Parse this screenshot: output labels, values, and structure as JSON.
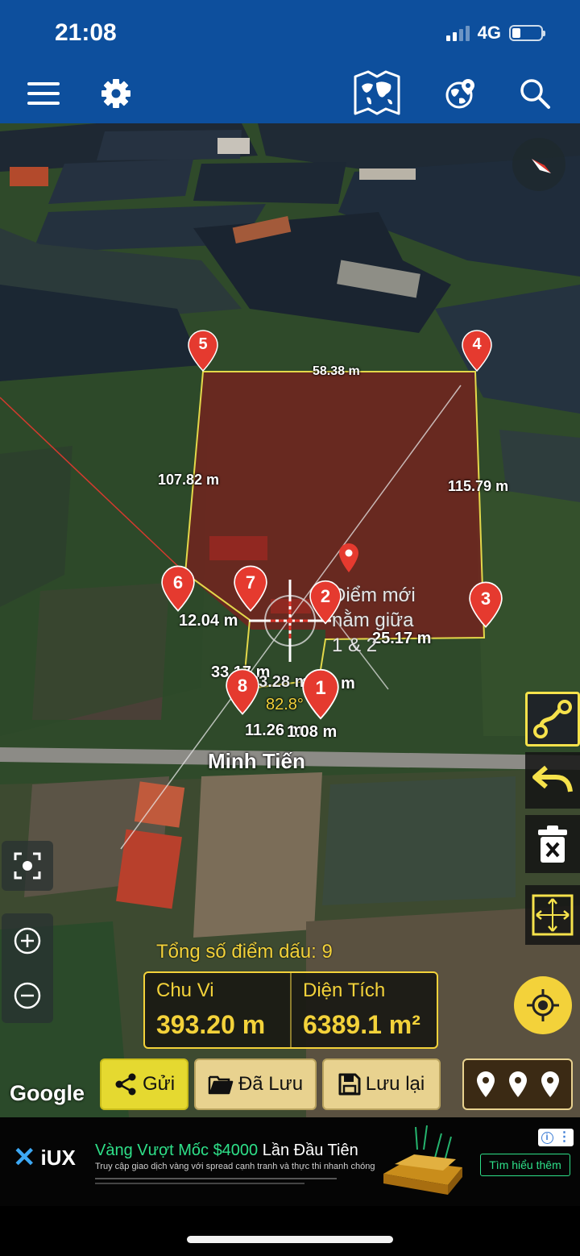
{
  "status_bar": {
    "time": "21:08",
    "network": "4G"
  },
  "toolbar": {
    "icons": [
      "menu-icon",
      "settings-icon",
      "world-map-icon",
      "globe-pin-icon",
      "search-icon"
    ],
    "colors": {
      "bar": "#0d4f9d"
    }
  },
  "map": {
    "street_label": "Minh Tiến",
    "edge_labels": [
      "58.38 m",
      "107.82 m",
      "115.79 m",
      "12.04 m",
      "25.17 m",
      "33.17 m",
      "33.28 m",
      "11.26 m",
      "1.08 m",
      "m"
    ],
    "angle_label": "82.8°",
    "points": [
      "1",
      "2",
      "3",
      "4",
      "5",
      "6",
      "7",
      "8"
    ],
    "midpoint_note": [
      "Điểm mới",
      "nằm giữa",
      "1 & 2"
    ],
    "attribution": "Google",
    "colors": {
      "pin": "#e53a2f",
      "boundary": "#e3d84a",
      "area_fill": "#8a1d1d"
    }
  },
  "summary": {
    "point_count_label": "Tổng số điểm dấu: 9",
    "perimeter_label": "Chu Vi",
    "perimeter_value": "393.20 m",
    "area_label": "Diện Tích",
    "area_value": "6389.1 m²",
    "accent": "#f3d23a"
  },
  "actions": {
    "send_label": "Gửi",
    "saved_label": "Đã Lưu",
    "save_label": "Lưu lại"
  },
  "ad": {
    "brand": "iUX",
    "title_highlight": "Vàng Vượt Mốc $4000",
    "title_rest": " Lần Đầu Tiên",
    "subtitle": "Truy cập giao dịch vàng với spread cạnh tranh và thực thi nhanh chóng",
    "cta": "Tìm hiểu thêm"
  }
}
